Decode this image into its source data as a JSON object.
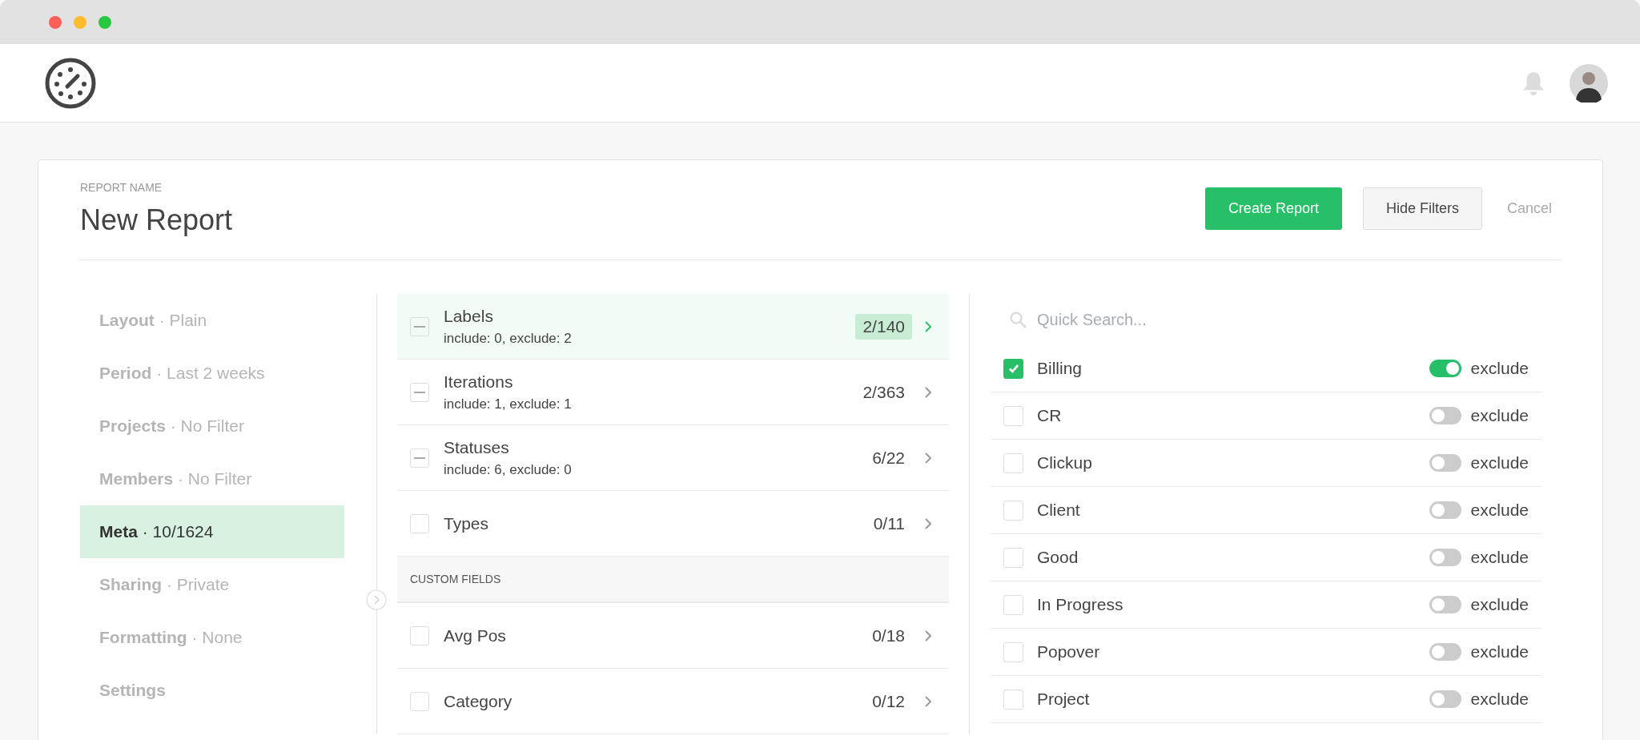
{
  "report": {
    "label": "REPORT NAME",
    "title": "New Report"
  },
  "actions": [
    {
      "kind": "primary",
      "label": "Create Report"
    },
    {
      "kind": "secondary",
      "label": "Hide Filters"
    },
    {
      "kind": "link",
      "label": "Cancel"
    }
  ],
  "sidebar": {
    "items": [
      {
        "label": "**Layout** · Plain",
        "selected": false
      },
      {
        "label": "**Period** · Last 2 weeks",
        "selected": false
      },
      {
        "label": "**Projects** · No Filter",
        "selected": false
      },
      {
        "label": "**Members** · No Filter",
        "selected": false
      },
      {
        "label": "**Meta** · 10/1624",
        "selected": true
      },
      {
        "label": "**Sharing** · Private",
        "selected": false
      },
      {
        "label": "**Formatting** · None",
        "selected": false
      },
      {
        "label": "**Settings**",
        "selected": false
      }
    ]
  },
  "filters": [
    {
      "kind": "filter",
      "name": "Labels",
      "detail": "include: 0, exclude: 2",
      "count": "2/140",
      "partial": true,
      "selected": true
    },
    {
      "kind": "filter",
      "name": "Iterations",
      "detail": "include: 1, exclude: 1",
      "count": "2/363",
      "partial": true,
      "selected": false
    },
    {
      "kind": "filter",
      "name": "Statuses",
      "detail": "include: 6, exclude: 0",
      "count": "6/22",
      "partial": true,
      "selected": false
    },
    {
      "kind": "filter",
      "name": "Types",
      "count": "0/11",
      "partial": false,
      "selected": false
    },
    {
      "kind": "section",
      "name": "CUSTOM FIELDS"
    },
    {
      "kind": "filter",
      "name": "Avg Pos",
      "count": "0/18",
      "partial": false,
      "selected": false
    },
    {
      "kind": "filter",
      "name": "Category",
      "count": "0/12",
      "partial": false,
      "selected": false
    }
  ],
  "values": {
    "search": {
      "placeholder": "Quick Search..."
    },
    "items": [
      {
        "name": "Billing",
        "checked": true,
        "exclude": true,
        "toggle_label": "exclude"
      },
      {
        "name": "CR",
        "checked": false,
        "exclude": false,
        "toggle_label": "exclude"
      },
      {
        "name": "Clickup",
        "checked": false,
        "exclude": false,
        "toggle_label": "exclude"
      },
      {
        "name": "Client",
        "checked": false,
        "exclude": false,
        "toggle_label": "exclude"
      },
      {
        "name": "Good",
        "checked": false,
        "exclude": false,
        "toggle_label": "exclude"
      },
      {
        "name": "In Progress",
        "checked": false,
        "exclude": false,
        "toggle_label": "exclude"
      },
      {
        "name": "Popover",
        "checked": false,
        "exclude": false,
        "toggle_label": "exclude"
      },
      {
        "name": "Project",
        "checked": false,
        "exclude": false,
        "toggle_label": "exclude"
      }
    ]
  }
}
